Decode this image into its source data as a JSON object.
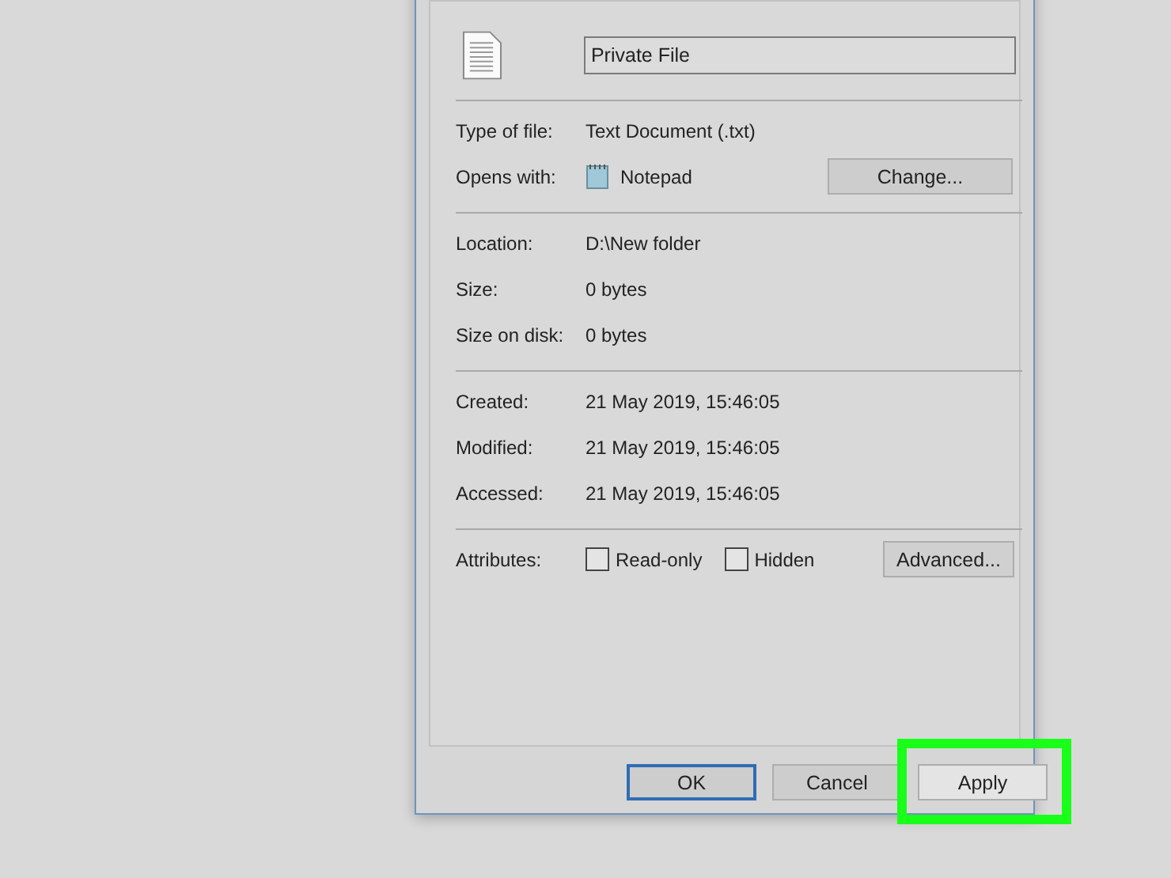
{
  "file_name": {
    "value": "Private File"
  },
  "type_section": [
    {
      "label": "Type of file:",
      "value": "Text Document (.txt)",
      "kind": "text"
    },
    {
      "label": "Opens with:",
      "value": "Notepad",
      "kind": "app",
      "button": "Change..."
    }
  ],
  "location_section": [
    {
      "label": "Location:",
      "value": "D:\\New folder"
    },
    {
      "label": "Size:",
      "value": "0 bytes"
    },
    {
      "label": "Size on disk:",
      "value": "0 bytes"
    }
  ],
  "date_section": [
    {
      "label": "Created:",
      "value": "21 May 2019, 15:46:05"
    },
    {
      "label": "Modified:",
      "value": "21 May 2019, 15:46:05"
    },
    {
      "label": "Accessed:",
      "value": "21 May 2019, 15:46:05"
    }
  ],
  "attributes": {
    "label": "Attributes:",
    "checkboxes": [
      {
        "label": "Read-only",
        "checked": false
      },
      {
        "label": "Hidden",
        "checked": false
      }
    ],
    "button": "Advanced..."
  },
  "buttons": [
    {
      "label": "OK",
      "default": true,
      "highlighted": false
    },
    {
      "label": "Cancel",
      "default": false,
      "highlighted": false
    },
    {
      "label": "Apply",
      "default": false,
      "highlighted": true
    }
  ]
}
